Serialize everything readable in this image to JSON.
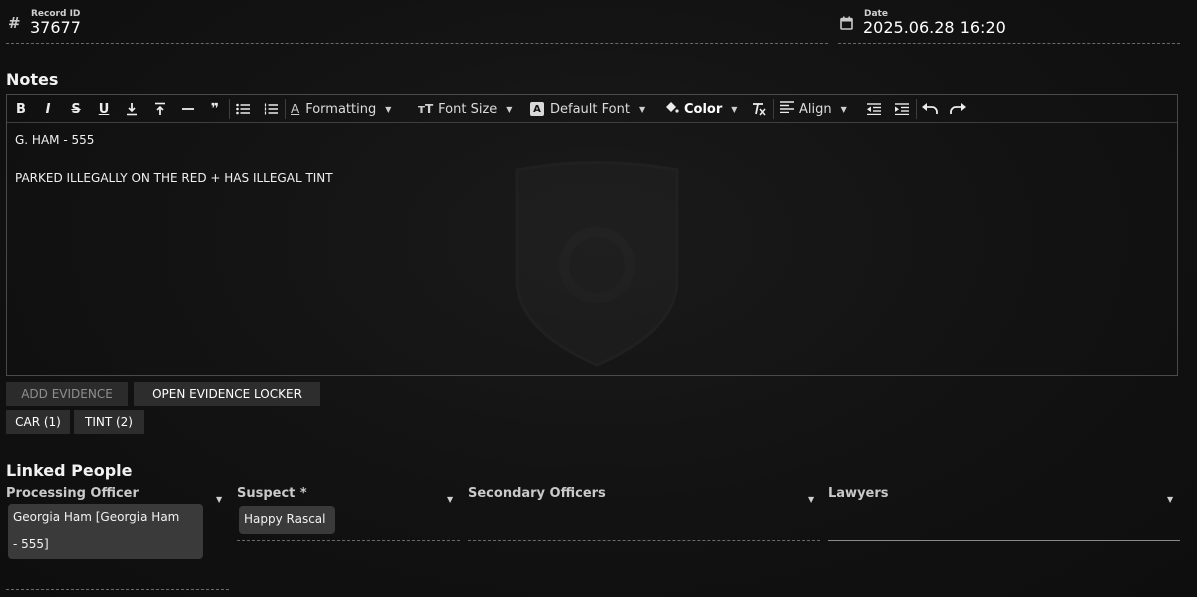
{
  "record": {
    "label": "Record ID",
    "value": "37677",
    "icon": "hash-icon"
  },
  "date": {
    "label": "Date",
    "value": "2025.06.28 16:20",
    "icon": "calendar-icon"
  },
  "notes": {
    "title": "Notes",
    "toolbar": {
      "bold": "B",
      "italic": "I",
      "strike": "S",
      "underline": "U",
      "subscript": "⊥",
      "superscript": "T",
      "hr": "—",
      "quote": "❞",
      "formatting": "Formatting",
      "font_size": "Font Size",
      "default_font": "Default Font",
      "color": "Color",
      "align": "Align"
    },
    "lines": [
      "G. HAM - 555",
      "PARKED ILLEGALLY ON THE RED + HAS ILLEGAL TINT"
    ]
  },
  "buttons": {
    "add_evidence": "ADD EVIDENCE",
    "open_locker": "OPEN EVIDENCE LOCKER",
    "tags": [
      "CAR (1)",
      "TINT (2)"
    ]
  },
  "linked_people": {
    "title": "Linked People",
    "processing_officer": {
      "label": "Processing Officer",
      "chip_line1": "Georgia Ham [Georgia Ham",
      "chip_line2": "- 555]"
    },
    "suspect": {
      "label": "Suspect *",
      "chip": "Happy Rascal"
    },
    "secondary_officers": {
      "label": "Secondary Officers"
    },
    "lawyers": {
      "label": "Lawyers"
    }
  }
}
